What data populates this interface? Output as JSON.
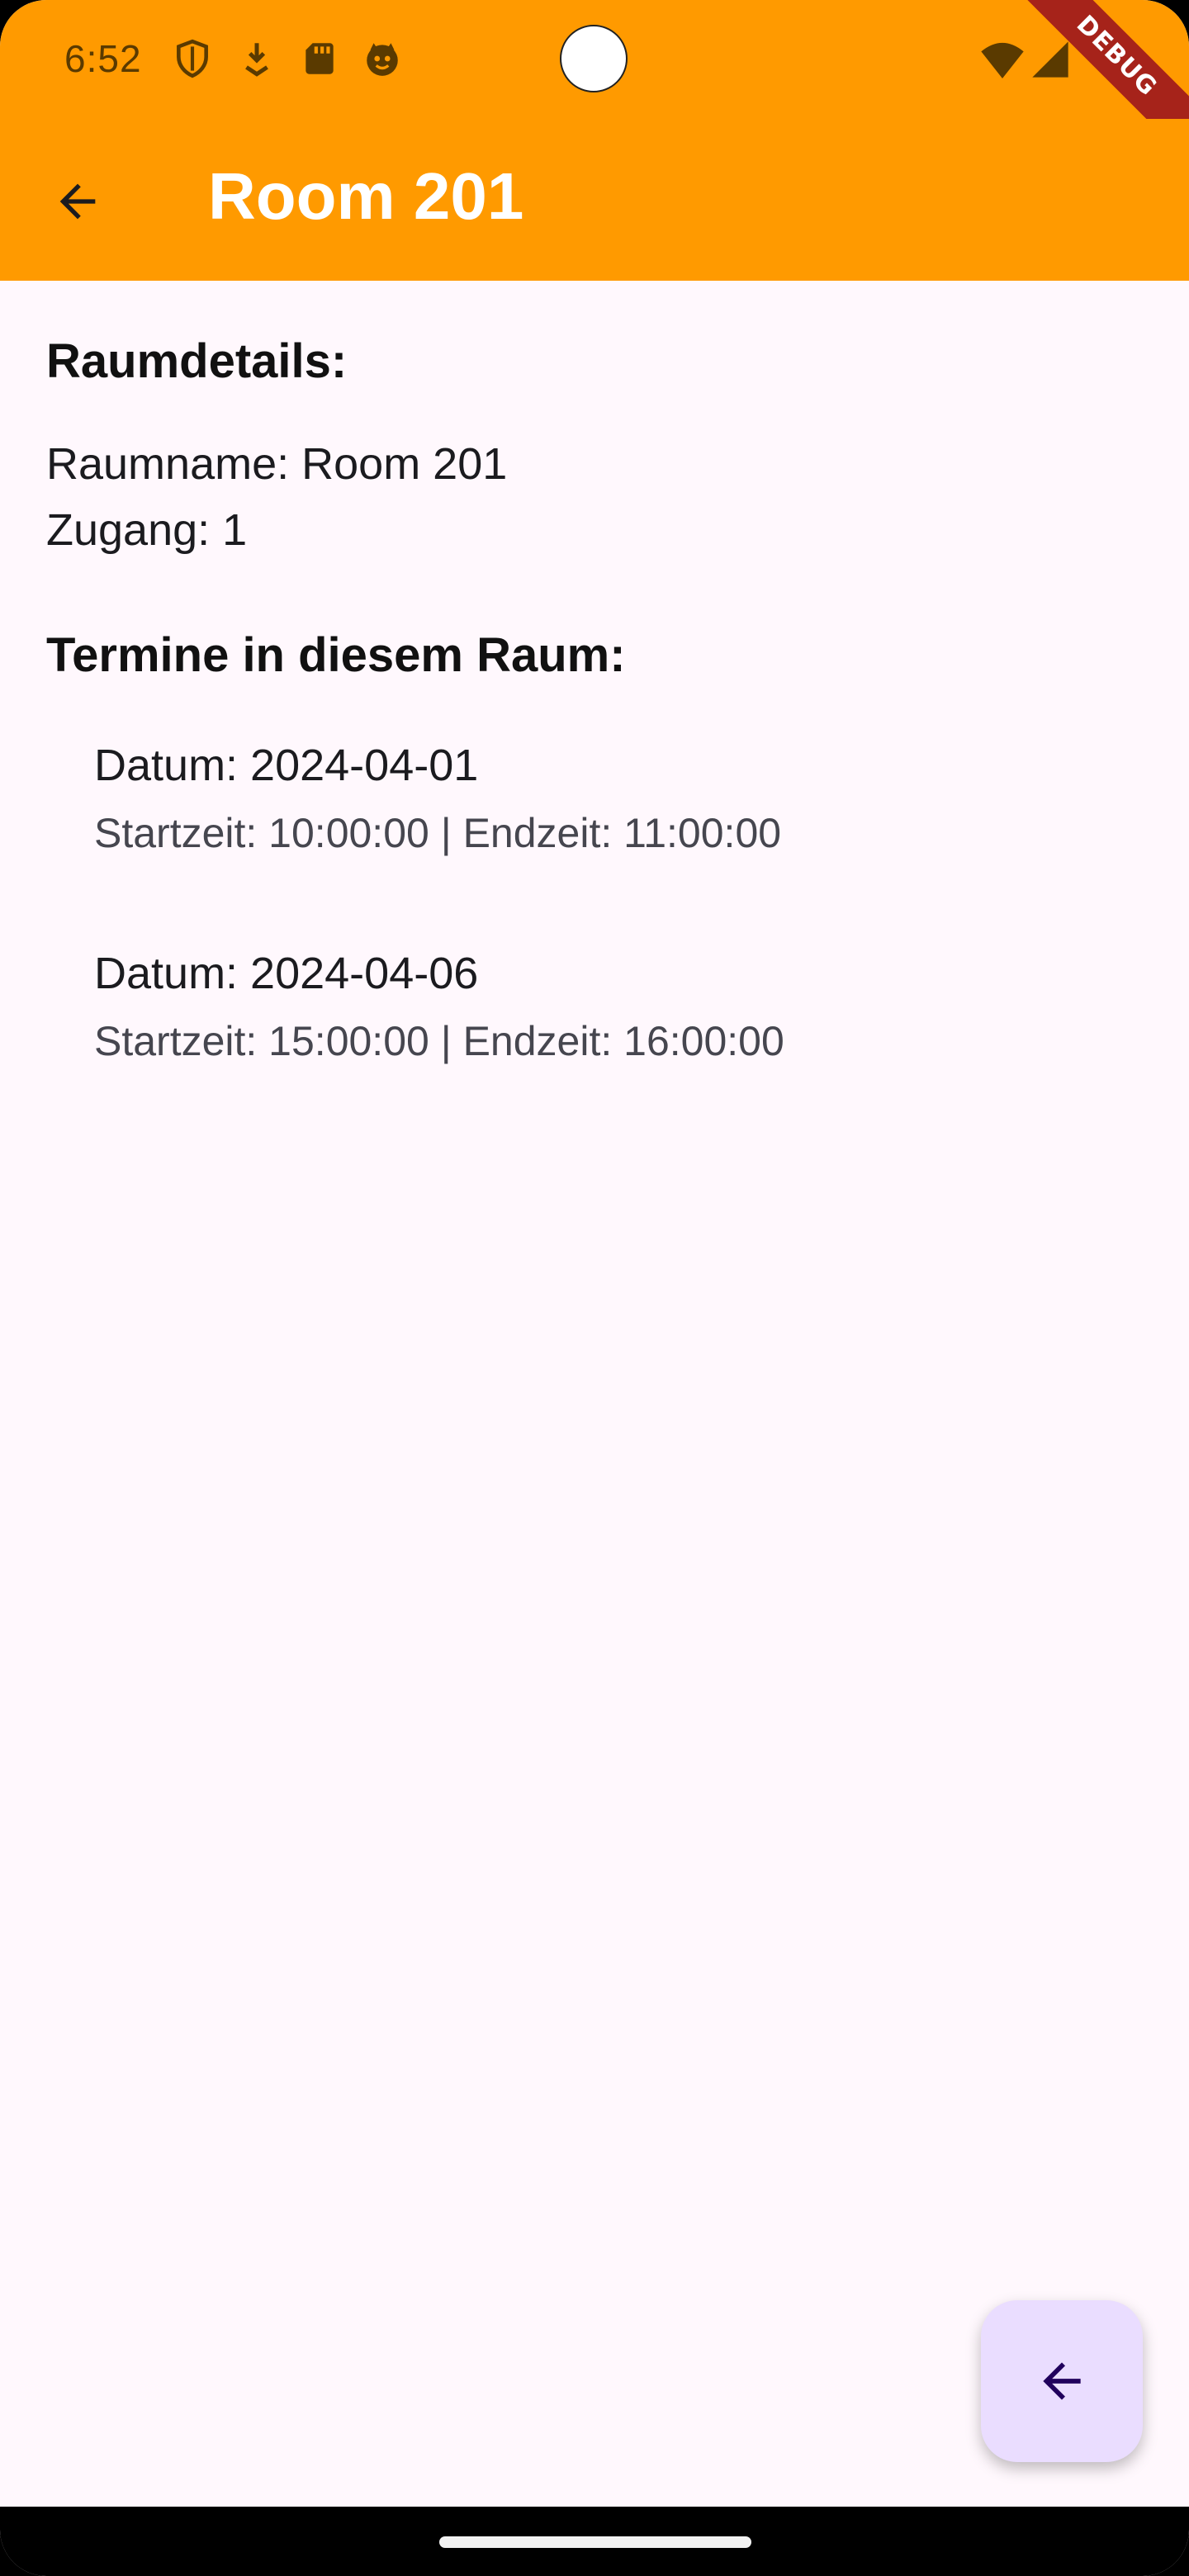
{
  "status_bar": {
    "time": "6:52",
    "icons_left": [
      "shield-icon",
      "download-icon",
      "sd-card-icon",
      "face-icon"
    ],
    "icons_right": [
      "wifi-icon",
      "signal-icon"
    ],
    "debug_label": "DEBUG"
  },
  "app_bar": {
    "title": "Room 201",
    "background": "#FF9A00",
    "back_icon": "arrow-back-icon"
  },
  "details": {
    "heading": "Raumdetails:",
    "room_name_line": "Raumname: Room 201",
    "access_line": "Zugang: 1"
  },
  "appointments": {
    "heading": "Termine in diesem Raum:",
    "items": [
      {
        "date_line": "Datum: 2024-04-01",
        "time_line": "Startzeit: 10:00:00 | Endzeit: 11:00:00"
      },
      {
        "date_line": "Datum: 2024-04-06",
        "time_line": "Startzeit: 15:00:00 | Endzeit: 16:00:00"
      }
    ]
  },
  "fab": {
    "icon": "arrow-back-icon",
    "background": "#EADDFF"
  }
}
